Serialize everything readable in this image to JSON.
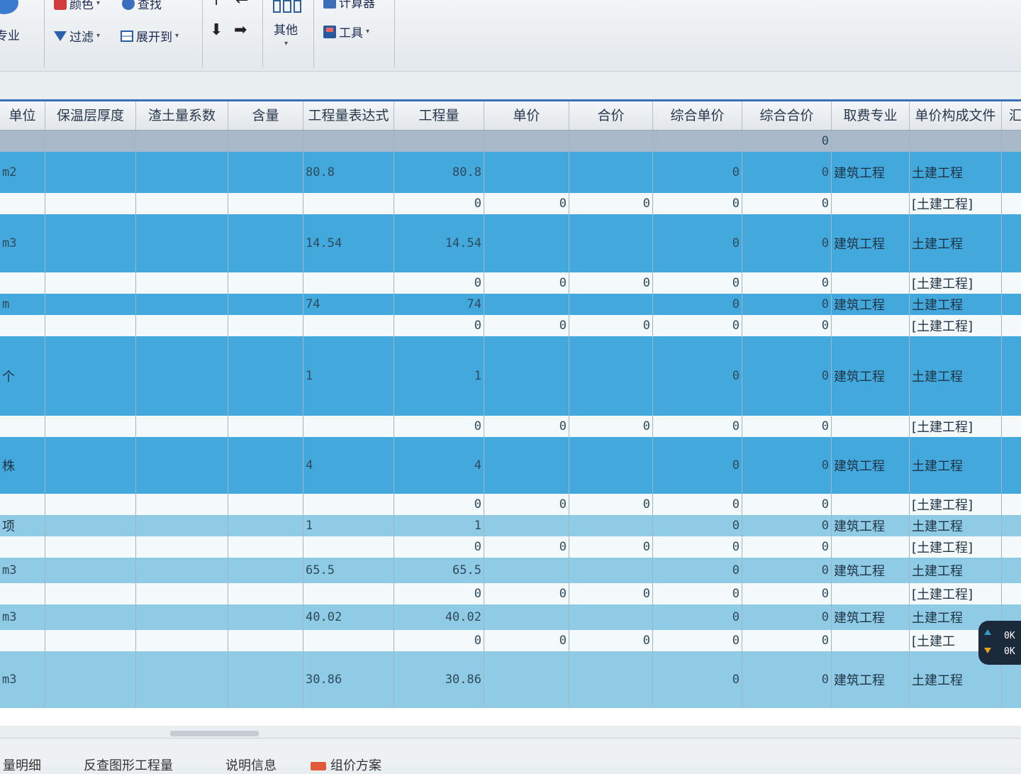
{
  "toolbar": {
    "color_label": "颜色",
    "find_label": "查找",
    "filter_label": "过滤",
    "expand_label": "展开到",
    "other_label": "其他",
    "tools_label": "工具",
    "specialty_label": "专业",
    "calc_label": "计算器"
  },
  "columns": [
    "单位",
    "保温层厚度",
    "渣土量系数",
    "含量",
    "工程量表达式",
    "工程量",
    "单价",
    "合价",
    "综合单价",
    "综合合价",
    "取费专业",
    "单价构成文件",
    "汇"
  ],
  "group_row": {
    "综合合价": "0"
  },
  "rows": [
    {
      "style": "blue",
      "unit": "m2",
      "expr": "80.8",
      "qty": "80.8",
      "unit_price": "",
      "total": "",
      "comp_price": "0",
      "comp_total": "0",
      "fee": "建筑工程",
      "file": "土建工程"
    },
    {
      "style": "white",
      "unit": "",
      "expr": "",
      "qty": "0",
      "unit_price": "0",
      "total": "0",
      "comp_price": "0",
      "comp_total": "0",
      "fee": "",
      "file": "[土建工程]"
    },
    {
      "style": "blue",
      "unit": "m3",
      "expr": "14.54",
      "qty": "14.54",
      "unit_price": "",
      "total": "",
      "comp_price": "0",
      "comp_total": "0",
      "fee": "建筑工程",
      "file": "土建工程"
    },
    {
      "style": "white",
      "unit": "",
      "expr": "",
      "qty": "0",
      "unit_price": "0",
      "total": "0",
      "comp_price": "0",
      "comp_total": "0",
      "fee": "",
      "file": "[土建工程]"
    },
    {
      "style": "blue",
      "unit": "m",
      "expr": "74",
      "qty": "74",
      "unit_price": "",
      "total": "",
      "comp_price": "0",
      "comp_total": "0",
      "fee": "建筑工程",
      "file": "土建工程"
    },
    {
      "style": "white",
      "unit": "",
      "expr": "",
      "qty": "0",
      "unit_price": "0",
      "total": "0",
      "comp_price": "0",
      "comp_total": "0",
      "fee": "",
      "file": "[土建工程]"
    },
    {
      "style": "blue",
      "unit": "个",
      "expr": "1",
      "qty": "1",
      "unit_price": "",
      "total": "",
      "comp_price": "0",
      "comp_total": "0",
      "fee": "建筑工程",
      "file": "土建工程"
    },
    {
      "style": "white",
      "unit": "",
      "expr": "",
      "qty": "0",
      "unit_price": "0",
      "total": "0",
      "comp_price": "0",
      "comp_total": "0",
      "fee": "",
      "file": "[土建工程]"
    },
    {
      "style": "blue",
      "unit": "株",
      "expr": "4",
      "qty": "4",
      "unit_price": "",
      "total": "",
      "comp_price": "0",
      "comp_total": "0",
      "fee": "建筑工程",
      "file": "土建工程"
    },
    {
      "style": "white",
      "unit": "",
      "expr": "",
      "qty": "0",
      "unit_price": "0",
      "total": "0",
      "comp_price": "0",
      "comp_total": "0",
      "fee": "",
      "file": "[土建工程]"
    },
    {
      "style": "light",
      "unit": "项",
      "expr": "1",
      "qty": "1",
      "unit_price": "",
      "total": "",
      "comp_price": "0",
      "comp_total": "0",
      "fee": "建筑工程",
      "file": "土建工程"
    },
    {
      "style": "white",
      "unit": "",
      "expr": "",
      "qty": "0",
      "unit_price": "0",
      "total": "0",
      "comp_price": "0",
      "comp_total": "0",
      "fee": "",
      "file": "[土建工程]"
    },
    {
      "style": "light",
      "unit": "m3",
      "expr": "65.5",
      "qty": "65.5",
      "unit_price": "",
      "total": "",
      "comp_price": "0",
      "comp_total": "0",
      "fee": "建筑工程",
      "file": "土建工程"
    },
    {
      "style": "white",
      "unit": "",
      "expr": "",
      "qty": "0",
      "unit_price": "0",
      "total": "0",
      "comp_price": "0",
      "comp_total": "0",
      "fee": "",
      "file": "[土建工程]"
    },
    {
      "style": "light",
      "unit": "m3",
      "expr": "40.02",
      "qty": "40.02",
      "unit_price": "",
      "total": "",
      "comp_price": "0",
      "comp_total": "0",
      "fee": "建筑工程",
      "file": "土建工程"
    },
    {
      "style": "white",
      "unit": "",
      "expr": "",
      "qty": "0",
      "unit_price": "0",
      "total": "0",
      "comp_price": "0",
      "comp_total": "0",
      "fee": "",
      "file": "[土建工"
    },
    {
      "style": "light",
      "unit": "m3",
      "expr": "30.86",
      "qty": "30.86",
      "unit_price": "",
      "total": "",
      "comp_price": "0",
      "comp_total": "0",
      "fee": "建筑工程",
      "file": "土建工程"
    }
  ],
  "bottom_tabs": [
    "量明细",
    "反查图形工程量",
    "说明信息",
    "组价方案"
  ],
  "widget": {
    "up": "0K",
    "down": "0K"
  }
}
